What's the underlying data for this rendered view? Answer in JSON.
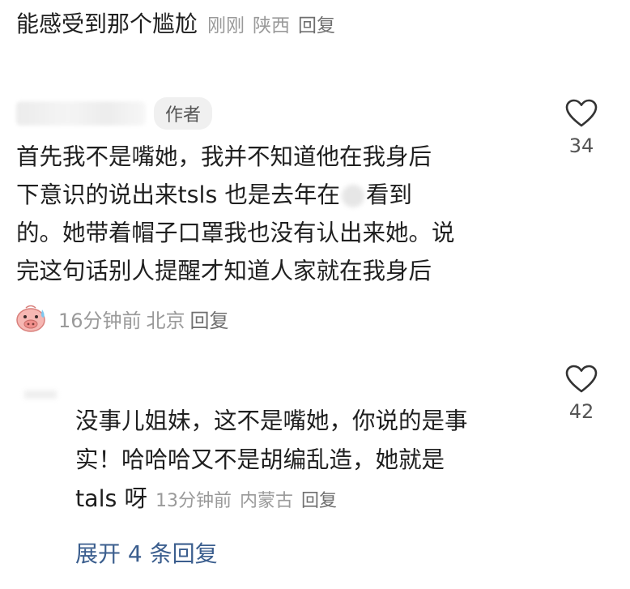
{
  "top_comment": {
    "text": "能感受到那个尴尬",
    "time": "刚刚",
    "location": "陕西",
    "reply": "回复"
  },
  "author_comment": {
    "badge": "作者",
    "lines": [
      "首先我不是嘴她，我并不知道他在我身后",
      "下意识的说出来tsls 也是去年在",
      "看到",
      "的。她带着帽子口罩我也没有认出来她。说",
      "完这句话别人提醒才知道人家就在我身后"
    ],
    "likes": "34",
    "time": "16分钟前",
    "location": "北京",
    "reply": "回复",
    "emoji_icon": "sweating-pig-emoji-icon"
  },
  "reply_comment": {
    "lines": [
      "没事儿姐妹，这不是嘴她，你说的是事",
      "实！哈哈哈又不是胡编乱造，她就是",
      "tals 呀"
    ],
    "likes": "42",
    "time": "13分钟前",
    "location": "内蒙古",
    "reply": "回复"
  },
  "expand_replies": "展开 4 条回复",
  "colors": {
    "text": "#1f1f1f",
    "meta": "#9a9a9a",
    "link": "#3b5e8e"
  }
}
